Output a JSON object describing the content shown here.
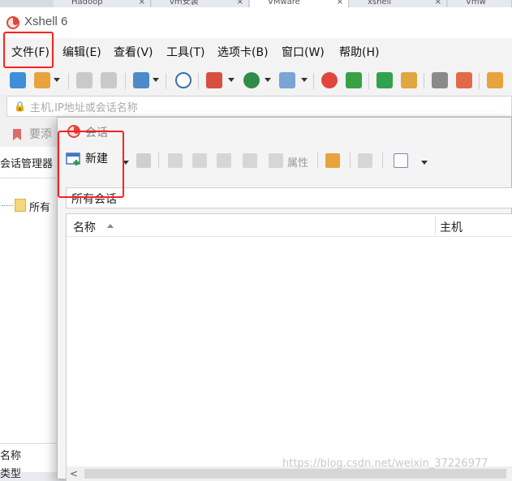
{
  "browser_tabs": [
    {
      "label": "Hadoop",
      "active": false
    },
    {
      "label": "vm安装",
      "active": false
    },
    {
      "label": "VMware",
      "active": true
    },
    {
      "label": "xshell",
      "active": false
    },
    {
      "label": "Vmw",
      "active": false
    }
  ],
  "app": {
    "title": "Xshell 6"
  },
  "menu": {
    "file": "文件(F)",
    "edit": "编辑(E)",
    "view": "查看(V)",
    "tools": "工具(T)",
    "tab": "选项卡(B)",
    "window": "窗口(W)",
    "help": "帮助(H)"
  },
  "address": {
    "placeholder": "主机,IP地址或会话名称"
  },
  "hint": {
    "text": "要添"
  },
  "session_manager": {
    "title": "会话管理器",
    "tree_item": "所有",
    "prop_name": "名称",
    "prop_type": "类型"
  },
  "dialog": {
    "title": "会话",
    "new_label": "新建",
    "properties_label": "属性",
    "breadcrumb": "所有会话",
    "columns": {
      "name": "名称",
      "host": "主机"
    }
  },
  "watermark": "https://blog.csdn.net/weixin_37226977",
  "colors": {
    "highlight": "#ff1f1f",
    "accent_logo": "#e0463b"
  }
}
